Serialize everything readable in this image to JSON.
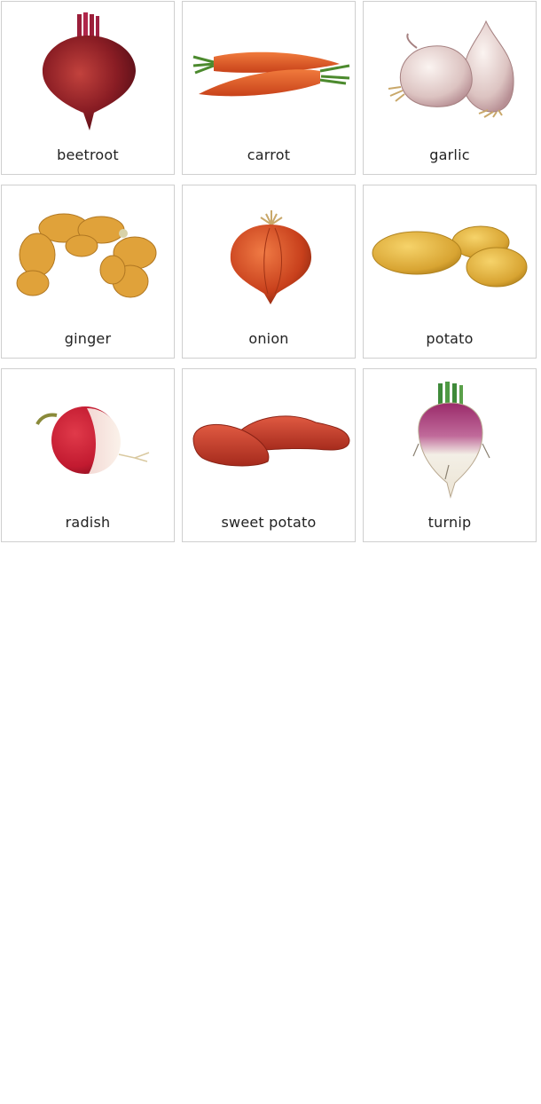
{
  "cards": [
    {
      "label": "beetroot",
      "icon": "beetroot-illustration"
    },
    {
      "label": "carrot",
      "icon": "carrot-illustration"
    },
    {
      "label": "garlic",
      "icon": "garlic-illustration"
    },
    {
      "label": "ginger",
      "icon": "ginger-illustration"
    },
    {
      "label": "onion",
      "icon": "onion-illustration"
    },
    {
      "label": "potato",
      "icon": "potato-illustration"
    },
    {
      "label": "radish",
      "icon": "radish-illustration"
    },
    {
      "label": "sweet potato",
      "icon": "sweet-potato-illustration"
    },
    {
      "label": "turnip",
      "icon": "turnip-illustration"
    }
  ]
}
